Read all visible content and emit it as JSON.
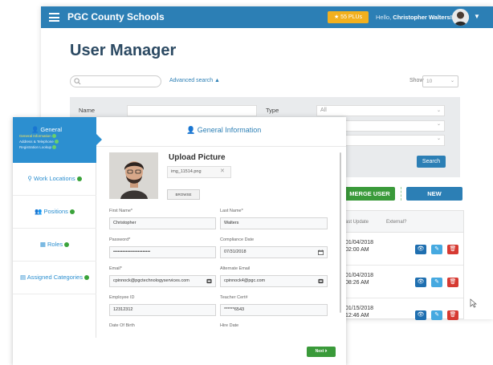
{
  "header": {
    "brand": "PGC County Schools",
    "plus_badge": "★ 55 PLUs",
    "greeting": "Hello,",
    "user_name": "Christopher Walters!",
    "accent_color": "#2c7fb5"
  },
  "page": {
    "title": "User Manager",
    "advanced_search": "Advanced search ▲",
    "show_label": "Show",
    "show_value": "10"
  },
  "filters": {
    "name_label": "Name",
    "type_label": "Type",
    "type_value": "All",
    "search_button": "Search"
  },
  "actions": {
    "merge_user": "MERGE USER",
    "new": "NEW"
  },
  "table": {
    "columns": [
      "ast Update",
      "External?"
    ],
    "rows": [
      {
        "date": "01/04/2018",
        "time": "02:00 AM"
      },
      {
        "date": "01/04/2018",
        "time": "08:26 AM"
      },
      {
        "date": "01/15/2018",
        "time": "12:46 AM"
      }
    ]
  },
  "modal": {
    "steps": {
      "general": "General",
      "general_subs": [
        "General Information",
        "Address & Telephone",
        "Registration Lookup"
      ],
      "work_locations": "Work Locations",
      "positions": "Positions",
      "roles": "Roles",
      "assigned_categories": "Assigned Categories"
    },
    "section_title": "General Information",
    "upload": {
      "title": "Upload Picture",
      "file_name": "img_11514.png",
      "browse": "BROWSE"
    },
    "fields": {
      "first_name_label": "First Name*",
      "first_name": "Christopher",
      "last_name_label": "Last Name*",
      "last_name": "Walters",
      "password_label": "Password*",
      "password": "••••••••••••••••••••••••",
      "compliance_label": "Compliance Date",
      "compliance": "07/31/2018",
      "email_label": "Email*",
      "email": "cpinnock@pgctechnologyservices.com",
      "alt_email_label": "Alternate Email",
      "alt_email": "cpinnock4@pgc.com",
      "employee_id_label": "Employee ID",
      "employee_id": "12312312",
      "teacher_cert_label": "Teacher Cert#",
      "teacher_cert": "******6543",
      "dob_label": "Date Of Birth",
      "hire_label": "Hire Date"
    },
    "next_button": "Next ⏵"
  }
}
